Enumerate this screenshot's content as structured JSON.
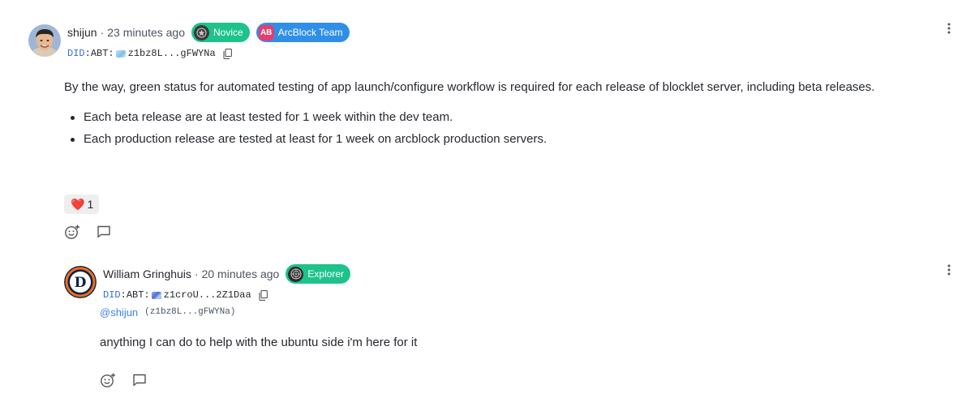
{
  "comments": [
    {
      "author": "shijun",
      "separator": "·",
      "time": "23 minutes ago",
      "badges": [
        {
          "label": "Novice",
          "color": "#1ec28b"
        },
        {
          "label": "ArcBlock Team",
          "logo": "AB",
          "color": "#2f8fe6"
        }
      ],
      "did": {
        "prefix": "DID",
        "colon": ":",
        "chain": "ABT:",
        "short": "z1bz8L...gFWYNa"
      },
      "text": "By the way, green status for automated testing of app launch/configure workflow is required for each release of blocklet server, including beta releases.",
      "bullets": [
        "Each beta release are at least tested for 1 week within the dev team.",
        "Each production release are tested at least for 1 week on arcblock production servers."
      ],
      "reaction": {
        "emoji": "❤️",
        "count": "1"
      }
    },
    {
      "author": "William Gringhuis",
      "separator": "·",
      "time": "20 minutes ago",
      "badges": [
        {
          "label": "Explorer",
          "color": "#1ec28b"
        }
      ],
      "did": {
        "prefix": "DID",
        "colon": ":",
        "chain": "ABT:",
        "short": "z1croU...2Z1Daa"
      },
      "mention": {
        "user": "@shijun",
        "did": "(z1bz8L...gFWYNa)"
      },
      "text": "anything I can do to help with the ubuntu side i'm here for it"
    }
  ],
  "icons": {
    "more": "more-vert-icon",
    "add_reaction": "add-reaction-icon",
    "reply": "comment-icon",
    "copy": "copy-icon"
  },
  "colors": {
    "link_blue": "#3b82f6",
    "badge_green": "#1ec28b",
    "badge_blue": "#2f8fe6",
    "ab_red": "#e63d6e",
    "heart": "#e0182d"
  }
}
